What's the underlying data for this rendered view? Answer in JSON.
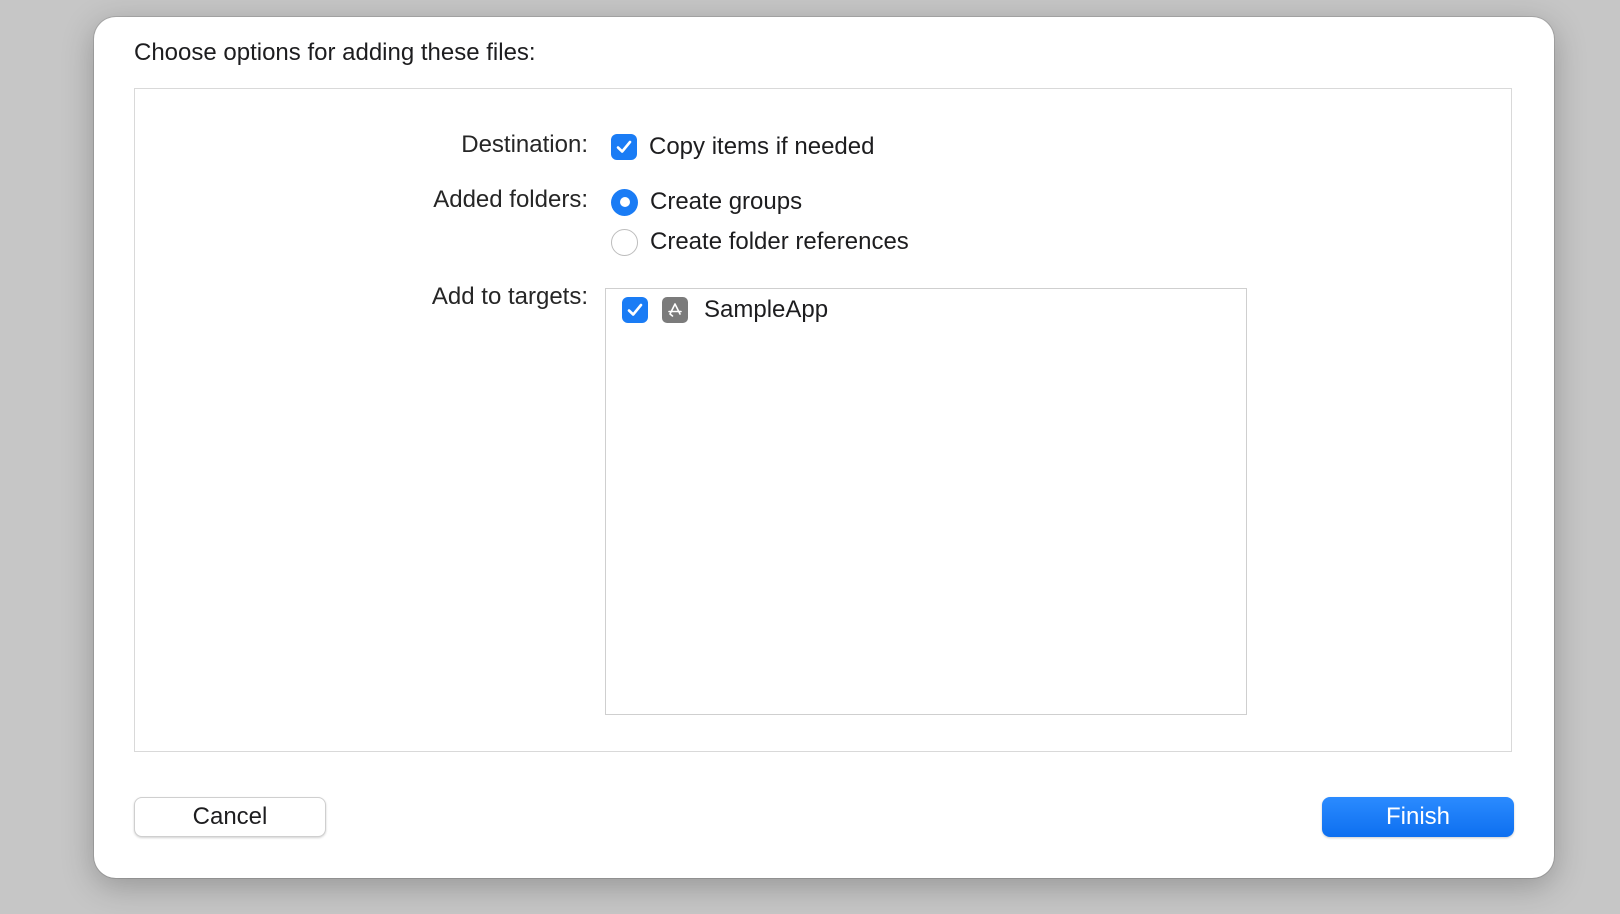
{
  "dialog": {
    "title": "Choose options for adding these files:"
  },
  "options": {
    "destination": {
      "label": "Destination:",
      "checkbox_label": "Copy items if needed",
      "checked": true
    },
    "added_folders": {
      "label": "Added folders:",
      "choices": [
        {
          "label": "Create groups",
          "selected": true
        },
        {
          "label": "Create folder references",
          "selected": false
        }
      ]
    },
    "targets": {
      "label": "Add to targets:",
      "items": [
        {
          "name": "SampleApp",
          "checked": true,
          "icon": "app-store-icon"
        }
      ]
    }
  },
  "buttons": {
    "cancel_label": "Cancel",
    "finish_label": "Finish"
  },
  "colors": {
    "accent": "#1a7cf5",
    "backdrop": "#c6c6c6"
  }
}
